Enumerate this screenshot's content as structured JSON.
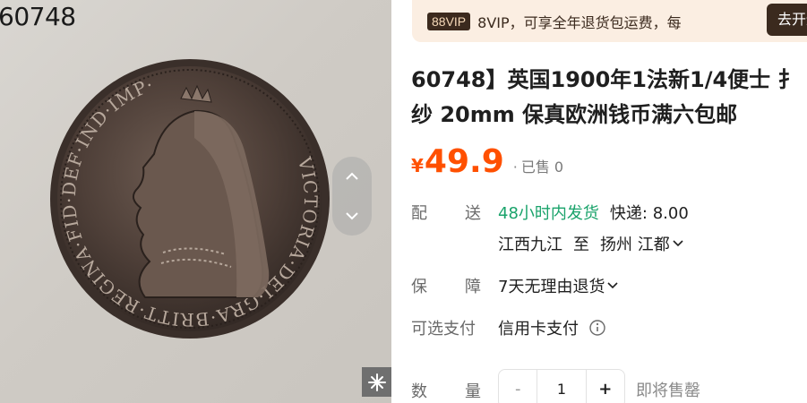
{
  "image": {
    "caption": "60748",
    "coin_legend": "VICTORIA·DEI·GRA·BRITT·REGINA·FID·DEF·IND·IMP·"
  },
  "vip": {
    "badge": "88VIP",
    "text": "8VIP，可享全年退货包运费，每",
    "button": "去开通"
  },
  "product": {
    "title_line1": "60748】英国1900年1法新1/4便士 扌",
    "title_line2": "纱 20mm 保真欧洲钱币满六包邮",
    "currency": "¥",
    "price": "49.9",
    "sold_dot": "·",
    "sold": "已售 0"
  },
  "delivery": {
    "label_a": "配",
    "label_b": "送",
    "ship_time": "48小时内发货",
    "express": "快递: 8.00",
    "from": "江西九江",
    "to_word": "至",
    "to": "扬州 江都"
  },
  "guarantee": {
    "label_a": "保",
    "label_b": "障",
    "value": "7天无理由退货"
  },
  "payment": {
    "label": "可选支付",
    "value": "信用卡支付"
  },
  "quantity": {
    "label_a": "数",
    "label_b": "量",
    "minus": "-",
    "value": "1",
    "plus": "+",
    "note": "即将售罄"
  },
  "colors": {
    "price": "#ff5000",
    "green": "#1aa36b",
    "vip_dark": "#3b2a1e",
    "vip_bg": "#fbeee2"
  },
  "icons": [
    "chevron-up-icon",
    "chevron-down-icon",
    "zoom-sparkle-icon",
    "info-icon"
  ]
}
